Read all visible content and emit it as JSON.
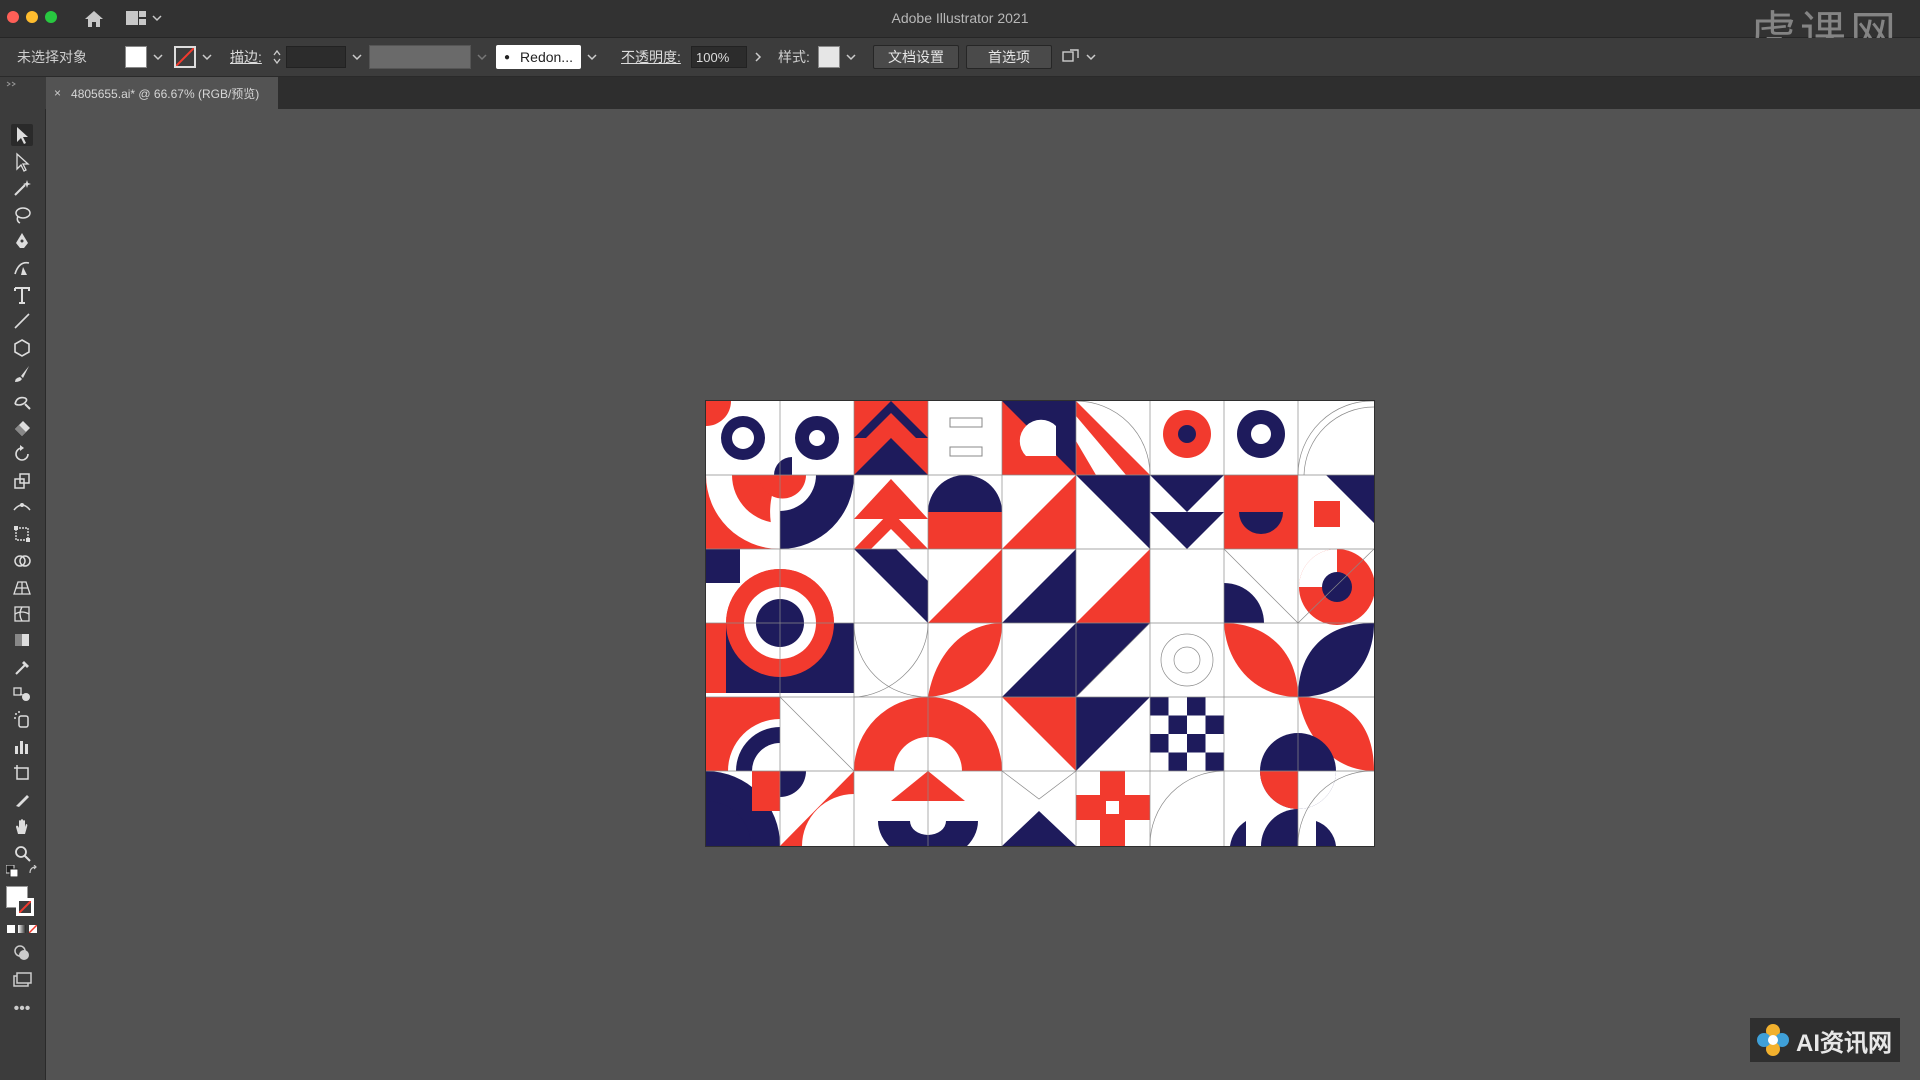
{
  "window": {
    "app_title": "Adobe Illustrator 2021",
    "watermark": "虎课网"
  },
  "control_bar": {
    "selection_label": "未选择对象",
    "stroke_label": "描边:",
    "brush_name": "Redon...",
    "opacity_label": "不透明度:",
    "opacity_value": "100%",
    "style_label": "样式:",
    "doc_setup_button": "文档设置",
    "prefs_button": "首选项"
  },
  "document_tab": {
    "title": "4805655.ai* @ 66.67% (RGB/预览)",
    "close_glyph": "×"
  },
  "colors": {
    "navy": "#1e1b5c",
    "red": "#f23a2e",
    "white": "#ffffff",
    "canvas": "#535353"
  },
  "toolbar": {
    "tools": [
      "selection-tool",
      "direct-selection-tool",
      "magic-wand-tool",
      "lasso-tool",
      "pen-tool",
      "curvature-tool",
      "type-tool",
      "line-segment-tool",
      "ellipse-tool",
      "paintbrush-tool",
      "shaper-tool",
      "eraser-tool",
      "rotate-tool",
      "scale-tool",
      "width-tool",
      "free-transform-tool",
      "shape-builder-tool",
      "perspective-grid-tool",
      "mesh-tool",
      "gradient-tool",
      "eyedropper-tool",
      "blend-tool",
      "symbol-sprayer-tool",
      "column-graph-tool",
      "artboard-tool",
      "slice-tool",
      "hand-tool",
      "zoom-tool"
    ]
  },
  "corner_logo": {
    "text": "AI资讯网"
  }
}
